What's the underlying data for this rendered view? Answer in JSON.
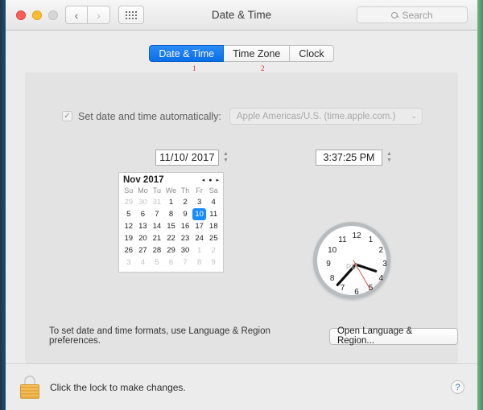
{
  "window": {
    "title": "Date & Time",
    "traffic_lights": [
      "close",
      "minimize",
      "zoom"
    ],
    "nav": {
      "back": "‹",
      "forward": "›"
    },
    "show_all_icon": "grid-icon"
  },
  "search": {
    "placeholder": "Search",
    "icon": "search-icon"
  },
  "tabs": [
    {
      "label": "Date & Time",
      "active": true,
      "annotation": "1"
    },
    {
      "label": "Time Zone",
      "active": false,
      "annotation": "2"
    },
    {
      "label": "Clock",
      "active": false,
      "annotation": ""
    }
  ],
  "auto": {
    "checkbox_checked": true,
    "checkmark": "✓",
    "label": "Set date and time automatically:",
    "server_value": "Apple Americas/U.S. (time.apple.com.)",
    "chevron": "⌄"
  },
  "date_field": {
    "value": "11/10/ 2017",
    "stepper_up": "▲",
    "stepper_down": "▼"
  },
  "time_field": {
    "value": "3:37:25 PM",
    "stepper_up": "▲",
    "stepper_down": "▼"
  },
  "calendar": {
    "month_label": "Nov 2017",
    "nav_prev": "◂",
    "nav_today": "●",
    "nav_next": "▸",
    "weekdays": [
      "Su",
      "Mo",
      "Tu",
      "We",
      "Th",
      "Fr",
      "Sa"
    ],
    "selected_day": 10,
    "weeks": [
      [
        {
          "d": "29",
          "out": true
        },
        {
          "d": "30",
          "out": true
        },
        {
          "d": "31",
          "out": true
        },
        {
          "d": "1"
        },
        {
          "d": "2"
        },
        {
          "d": "3"
        },
        {
          "d": "4"
        }
      ],
      [
        {
          "d": "5"
        },
        {
          "d": "6"
        },
        {
          "d": "7"
        },
        {
          "d": "8"
        },
        {
          "d": "9"
        },
        {
          "d": "10",
          "sel": true
        },
        {
          "d": "11"
        }
      ],
      [
        {
          "d": "12"
        },
        {
          "d": "13"
        },
        {
          "d": "14"
        },
        {
          "d": "15"
        },
        {
          "d": "16"
        },
        {
          "d": "17"
        },
        {
          "d": "18"
        }
      ],
      [
        {
          "d": "19"
        },
        {
          "d": "20"
        },
        {
          "d": "21"
        },
        {
          "d": "22"
        },
        {
          "d": "23"
        },
        {
          "d": "24"
        },
        {
          "d": "25"
        }
      ],
      [
        {
          "d": "26"
        },
        {
          "d": "27"
        },
        {
          "d": "28"
        },
        {
          "d": "29"
        },
        {
          "d": "30"
        },
        {
          "d": "1",
          "out": true
        },
        {
          "d": "2",
          "out": true
        }
      ],
      [
        {
          "d": "3",
          "out": true
        },
        {
          "d": "4",
          "out": true
        },
        {
          "d": "5",
          "out": true
        },
        {
          "d": "6",
          "out": true
        },
        {
          "d": "7",
          "out": true
        },
        {
          "d": "8",
          "out": true
        },
        {
          "d": "9",
          "out": true
        }
      ]
    ]
  },
  "clock": {
    "meridiem": "PM",
    "numerals": [
      "12",
      "1",
      "2",
      "3",
      "4",
      "5",
      "6",
      "7",
      "8",
      "9",
      "10",
      "11"
    ],
    "hour_angle": 108.5,
    "minute_angle": 222,
    "second_angle": 150
  },
  "note": {
    "text": "To set date and time formats, use Language & Region preferences.",
    "button_label": "Open Language & Region..."
  },
  "footer": {
    "lock_icon": "unlocked-padlock-icon",
    "text": "Click the lock to make changes.",
    "help_label": "?"
  }
}
